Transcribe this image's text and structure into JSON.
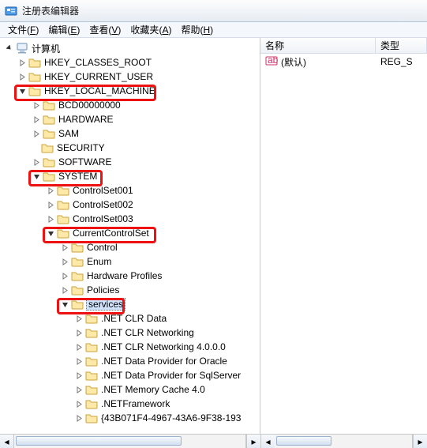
{
  "window": {
    "title": "注册表编辑器"
  },
  "menus": {
    "file": {
      "label": "文件",
      "accel": "F"
    },
    "edit": {
      "label": "编辑",
      "accel": "E"
    },
    "view": {
      "label": "查看",
      "accel": "V"
    },
    "fav": {
      "label": "收藏夹",
      "accel": "A"
    },
    "help": {
      "label": "帮助",
      "accel": "H"
    }
  },
  "tree": {
    "root": "计算机",
    "hkcr": "HKEY_CLASSES_ROOT",
    "hkcu": "HKEY_CURRENT_USER",
    "hklm": "HKEY_LOCAL_MACHINE",
    "bcd": "BCD00000000",
    "hw": "HARDWARE",
    "sam": "SAM",
    "sec": "SECURITY",
    "sw": "SOFTWARE",
    "sys": "SYSTEM",
    "cs001": "ControlSet001",
    "cs002": "ControlSet002",
    "cs003": "ControlSet003",
    "ccs": "CurrentControlSet",
    "ctrl": "Control",
    "enum": "Enum",
    "hwp": "Hardware Profiles",
    "pol": "Policies",
    "svc": "services",
    "s1": ".NET CLR Data",
    "s2": ".NET CLR Networking",
    "s3": ".NET CLR Networking 4.0.0.0",
    "s4": ".NET Data Provider for Oracle",
    "s5": ".NET Data Provider for SqlServer",
    "s6": ".NET Memory Cache 4.0",
    "s7": ".NETFramework",
    "s8": "{43B071F4-4967-43A6-9F38-193"
  },
  "grid": {
    "col_name": "名称",
    "col_type": "类型",
    "default_value_name": "(默认)",
    "default_value_type": "REG_S"
  }
}
